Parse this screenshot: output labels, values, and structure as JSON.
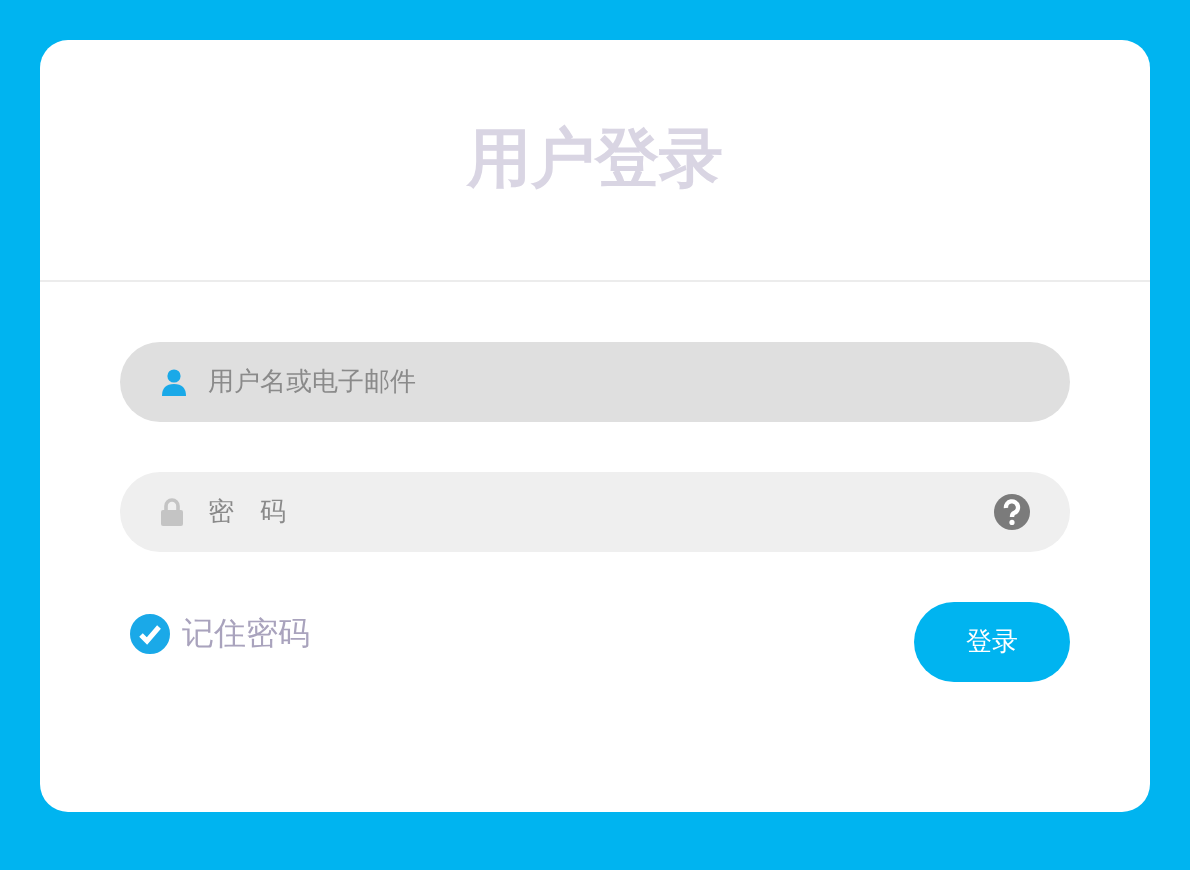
{
  "title": "用户登录",
  "fields": [
    {
      "kind": "text",
      "placeholder": "用户名或电子邮件",
      "focused": true
    },
    {
      "kind": "password",
      "placeholder": "密　码",
      "focused": false
    }
  ],
  "remember": {
    "label": "记住密码",
    "checked": true
  },
  "login_button": "登录"
}
